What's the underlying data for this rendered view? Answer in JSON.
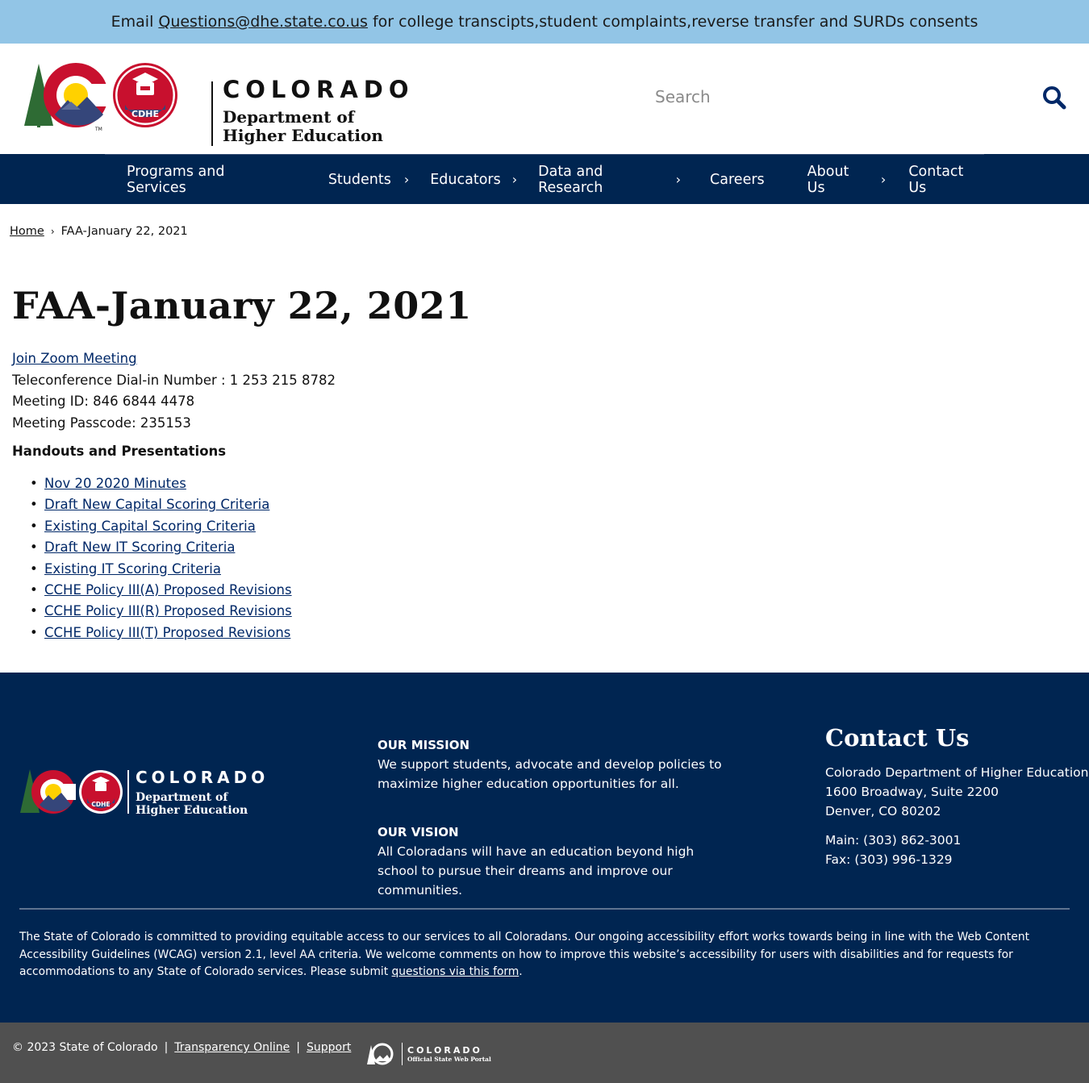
{
  "alert": {
    "prefix": "Email",
    "email": "Questions@dhe.state.co.us",
    "suffix": "for college transcipts,student complaints,reverse transfer and SURDs consents"
  },
  "header": {
    "logo": {
      "badge": "CDHE",
      "wordmark": "COLORADO",
      "dept_line1": "Department of",
      "dept_line2": "Higher Education"
    },
    "search": {
      "placeholder": "Search"
    }
  },
  "nav": {
    "items": [
      {
        "label": "Programs and Services",
        "has_submenu": false
      },
      {
        "label": "Students",
        "has_submenu": true
      },
      {
        "label": "Educators",
        "has_submenu": true
      },
      {
        "label": "Data and Research",
        "has_submenu": true
      },
      {
        "label": "Careers",
        "has_submenu": false
      },
      {
        "label": "About Us",
        "has_submenu": true
      },
      {
        "label": "Contact Us",
        "has_submenu": false
      }
    ]
  },
  "breadcrumb": {
    "home": "Home",
    "current": "FAA-January 22, 2021"
  },
  "page": {
    "title": "FAA-January 22, 2021",
    "zoom_link": "Join Zoom Meeting",
    "dial_in": "Teleconference Dial-in Number : 1 253 215 8782",
    "meeting_id": "Meeting ID: 846 6844 4478",
    "passcode": "Meeting Passcode: 235153",
    "handouts_heading": "Handouts and Presentations",
    "handouts": [
      "Nov 20 2020 Minutes",
      "Draft New Capital Scoring Criteria",
      "Existing Capital Scoring Criteria",
      "Draft New IT Scoring Criteria",
      "Existing IT Scoring Criteria",
      "CCHE Policy III(A) Proposed Revisions",
      "CCHE Policy III(R) Proposed Revisions",
      "CCHE Policy III(T) Proposed Revisions"
    ]
  },
  "footer": {
    "logo": {
      "badge": "CDHE",
      "wordmark": "COLORADO",
      "dept_line1": "Department of",
      "dept_line2": "Higher Education"
    },
    "mission_heading": "OUR MISSION",
    "mission_text": "We support students, advocate and develop policies to maximize higher education opportunities for all.",
    "vision_heading": "OUR VISION",
    "vision_text": "All Coloradans will have an education beyond high school to pursue their dreams and improve our communities.",
    "contact": {
      "heading": "Contact Us",
      "org": "Colorado Department of Higher Education",
      "street": "1600 Broadway, Suite 2200",
      "city": "Denver, CO 80202",
      "main": "Main: (303) 862-3001",
      "fax": "Fax: (303) 996-1329"
    },
    "accessibility_text": "The State of Colorado is committed to providing equitable access to our services to all Coloradans. Our ongoing accessibility effort works towards being in line with the Web Content Accessibility Guidelines (WCAG) version 2.1, level AA criteria. We welcome comments on how to improve this website’s accessibility for users with disabilities and for requests for accommodations to any State of Colorado services. Please submit",
    "accessibility_link": "questions via this form",
    "accessibility_end": "."
  },
  "bottom_bar": {
    "copyright": "© 2023 State of Colorado",
    "links": [
      "Transparency Online",
      "Support"
    ],
    "portal_wordmark": "COLORADO",
    "portal_sub": "Official State Web Portal"
  },
  "colors": {
    "alert_bg": "#92c5e6",
    "nav_bg": "#002551",
    "footer_bg": "#002551",
    "bottom_bg": "#505050",
    "link": "#002868",
    "logo_red": "#c8102e",
    "logo_yellow": "#ffd100",
    "logo_blue": "#35467a",
    "logo_green": "#2e6b34"
  }
}
